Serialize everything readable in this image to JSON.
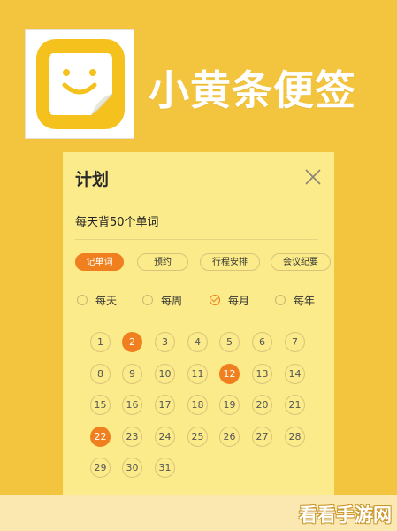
{
  "app": {
    "name": "小黄条便签",
    "colors": {
      "brand": "#f4c11d",
      "accent": "#f07f1f",
      "background": "#f3c43d",
      "card": "#fbeb8a"
    }
  },
  "plan": {
    "title": "计划",
    "close_icon": "close-icon",
    "note_text": "每天背50个单词",
    "tags": [
      {
        "label": "记单词",
        "selected": true
      },
      {
        "label": "预约",
        "selected": false
      },
      {
        "label": "行程安排",
        "selected": false
      },
      {
        "label": "会议纪要",
        "selected": false
      }
    ],
    "repeat_options": [
      {
        "label": "每天",
        "checked": false
      },
      {
        "label": "每周",
        "checked": false
      },
      {
        "label": "每月",
        "checked": true
      },
      {
        "label": "每年",
        "checked": false
      }
    ],
    "days": [
      "1",
      "2",
      "3",
      "4",
      "5",
      "6",
      "7",
      "8",
      "9",
      "10",
      "11",
      "12",
      "13",
      "14",
      "15",
      "16",
      "17",
      "18",
      "19",
      "20",
      "21",
      "22",
      "23",
      "24",
      "25",
      "26",
      "27",
      "28",
      "29",
      "30",
      "31"
    ],
    "selected_days": [
      "2",
      "12",
      "22"
    ]
  },
  "watermark": "看看手游网"
}
